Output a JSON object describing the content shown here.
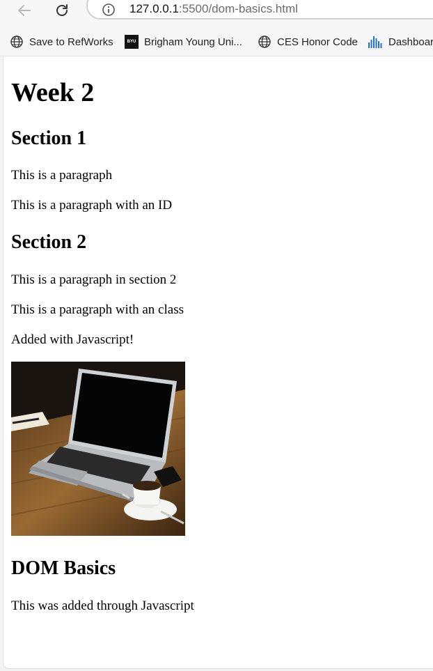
{
  "browser": {
    "url_host": "127.0.0.1",
    "url_path": ":5500/dom-basics.html",
    "bookmarks": [
      {
        "label": "Save to RefWorks",
        "icon": "globe-icon"
      },
      {
        "label": "Brigham Young Uni...",
        "icon": "byu-logo-icon"
      },
      {
        "label": "CES Honor Code",
        "icon": "globe-icon"
      },
      {
        "label": "Dashboard",
        "icon": "dashboard-bars-icon"
      }
    ]
  },
  "page": {
    "heading": "Week 2",
    "section1_title": "Section 1",
    "paragraph1": "This is a paragraph",
    "paragraph2": "This is a paragraph with an ID",
    "section2_title": "Section 2",
    "paragraph3": "This is a paragraph in section 2",
    "paragraph4": "This is a paragraph with an class",
    "paragraph5": "Added with Javascript!",
    "image_subject": "laptop on wooden desk with coffee cup",
    "dom_title": "DOM Basics",
    "paragraph6": "This was added through Javascript"
  }
}
